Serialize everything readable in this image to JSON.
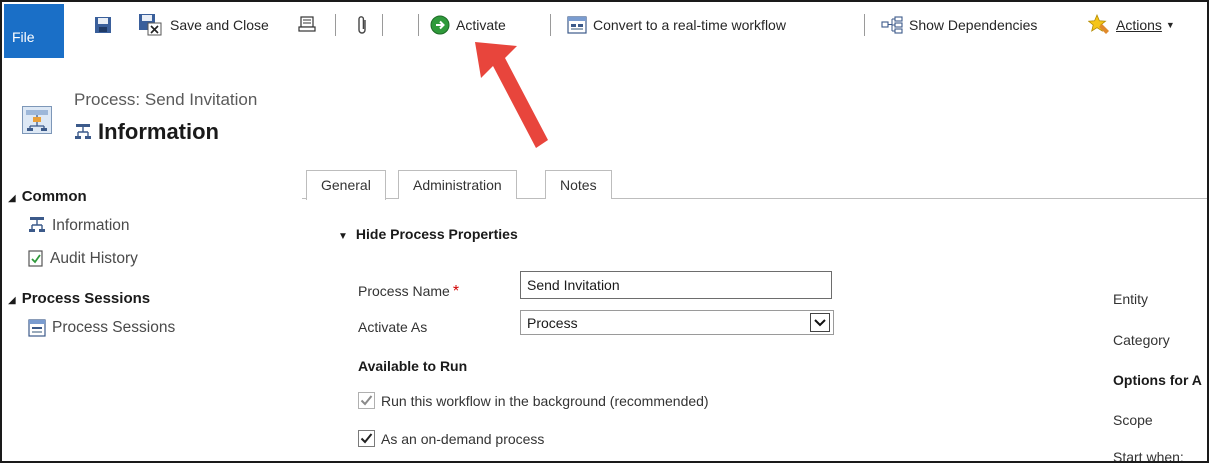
{
  "ribbon": {
    "file_label": "File",
    "save_close_label": "Save and Close",
    "activate_label": "Activate",
    "convert_label": "Convert to a real-time workflow",
    "dependencies_label": "Show Dependencies",
    "actions_label": "Actions",
    "accent": "#1a6fc7"
  },
  "header": {
    "subtitle": "Process: Send Invitation",
    "title": "Information"
  },
  "sidebar": {
    "common_heading": "Common",
    "common_items": [
      "Information",
      "Audit History"
    ],
    "sessions_heading": "Process Sessions",
    "sessions_items": [
      "Process Sessions"
    ]
  },
  "tabs": [
    "General",
    "Administration",
    "Notes"
  ],
  "form": {
    "section_heading": "Hide Process Properties",
    "process_name_label": "Process Name",
    "process_name_required": "*",
    "process_name_value": "Send Invitation",
    "activate_as_label": "Activate As",
    "activate_as_value": "Process",
    "available_heading": "Available to Run",
    "check_background": "Run this workflow in the background (recommended)",
    "check_on_demand": "As an on-demand process"
  },
  "right_labels": {
    "entity": "Entity",
    "category": "Category",
    "options": "Options for A",
    "scope": "Scope",
    "start_when": "Start when:"
  }
}
